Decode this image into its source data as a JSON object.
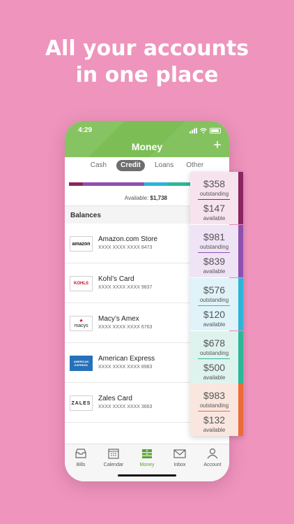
{
  "headline": {
    "line1": "All your accounts",
    "line2": "in one place"
  },
  "status": {
    "time": "4:29"
  },
  "app": {
    "title": "Money",
    "add_label": "+"
  },
  "tabs": [
    {
      "label": "Cash",
      "active": false
    },
    {
      "label": "Credit",
      "active": true
    },
    {
      "label": "Loans",
      "active": false
    },
    {
      "label": "Other",
      "active": false
    }
  ],
  "available": {
    "label": "Available:",
    "value": "$1,738"
  },
  "balances_label": "Balances",
  "colors": {
    "green": "#7cbe55",
    "plum": "#8b2561",
    "purple": "#8f4fb1",
    "blue": "#2cb4d9",
    "teal": "#2cb797",
    "orange": "#ec6b38"
  },
  "accounts": [
    {
      "name": "Amazon.com Store",
      "number": "XXXX XXXX XXXX 8473",
      "logo": "amazon"
    },
    {
      "name": "Kohl’s Card",
      "number": "XXXX XXXX XXXX 9837",
      "logo": "KOHLS"
    },
    {
      "name": "Macy’s Amex",
      "number": "XXXX XXXX XXXX 6763",
      "logo": "macys"
    },
    {
      "name": "American Express",
      "number": "XXXX XXXX XXXX 8983",
      "logo": "AMERICAN EXPRESS"
    },
    {
      "name": "Zales Card",
      "number": "XXXX XXXX XXXX 3663",
      "logo": "ZALES"
    }
  ],
  "cards": [
    {
      "outstanding": "$358",
      "available": "$147",
      "outstanding_label": "outstanding",
      "available_label": "available"
    },
    {
      "outstanding": "$981",
      "available": "$839",
      "outstanding_label": "outstanding",
      "available_label": "available"
    },
    {
      "outstanding": "$576",
      "available": "$120",
      "outstanding_label": "outstanding",
      "available_label": "available"
    },
    {
      "outstanding": "$678",
      "available": "$500",
      "outstanding_label": "outstanding",
      "available_label": "available"
    },
    {
      "outstanding": "$983",
      "available": "$132",
      "outstanding_label": "outstanding",
      "available_label": "available"
    }
  ],
  "nav": [
    {
      "label": "Bills",
      "icon": "inbox-tray-icon",
      "active": false
    },
    {
      "label": "Calendar",
      "icon": "calendar-icon",
      "active": false
    },
    {
      "label": "Money",
      "icon": "money-stack-icon",
      "active": true
    },
    {
      "label": "Inbox",
      "icon": "envelope-icon",
      "active": false
    },
    {
      "label": "Account",
      "icon": "person-icon",
      "active": false
    }
  ]
}
